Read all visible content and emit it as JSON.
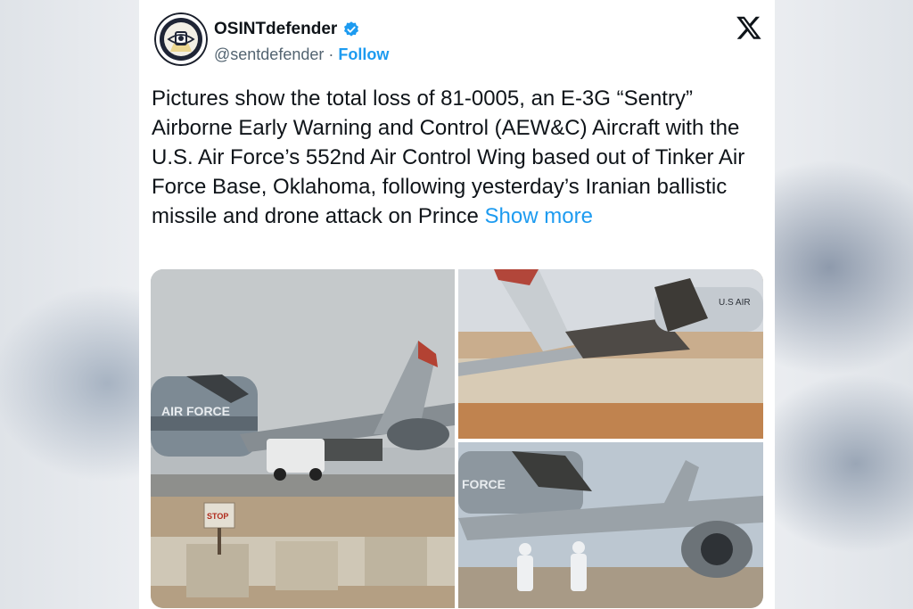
{
  "author": {
    "display_name": "OSINTdefender",
    "handle": "@sentdefender",
    "separator": "·",
    "follow_label": "Follow",
    "verified_color": "#1d9bf0",
    "avatar_icon": "osint-eye-logo"
  },
  "platform": {
    "logo_icon": "x-logo"
  },
  "tweet": {
    "text": "Pictures show the total loss of 81-0005, an E-3G “Sentry” Airborne Early Warning and Control (AEW&C) Aircraft with the U.S. Air Force’s 552nd Air Control Wing based out of Tinker Air Force Base, Oklahoma, following yesterday’s Iranian ballistic missile and drone attack on Prince",
    "show_more_label": "Show more"
  },
  "media": {
    "photos": [
      {
        "fuselage_text": "AIR FORCE",
        "sign_text": "STOP"
      },
      {
        "fuselage_text": "U.S AIR"
      },
      {
        "fuselage_text": "FORCE"
      }
    ]
  },
  "colors": {
    "accent": "#1d9bf0",
    "text_primary": "#0f1419",
    "text_secondary": "#536471"
  }
}
